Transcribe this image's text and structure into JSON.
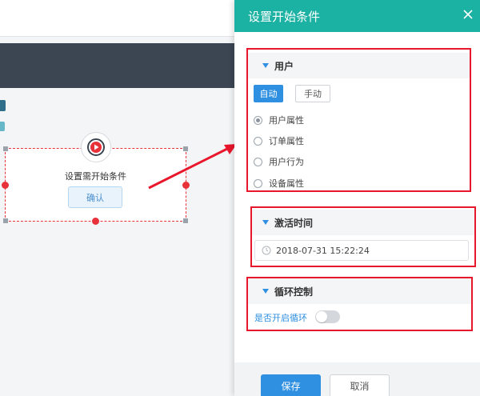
{
  "canvas": {
    "node": {
      "title": "设置需开始条件",
      "confirm_label": "确认",
      "icon": "play-icon"
    }
  },
  "panel": {
    "title": "设置开始条件",
    "close_icon": "close-icon",
    "user_section": {
      "label": "用户",
      "mode_auto": "自动",
      "mode_manual": "手动",
      "options": [
        {
          "label": "用户属性",
          "checked": true
        },
        {
          "label": "订单属性",
          "checked": false
        },
        {
          "label": "用户行为",
          "checked": false
        },
        {
          "label": "设备属性",
          "checked": false
        }
      ]
    },
    "activation_section": {
      "label": "激活时间",
      "datetime": "2018-07-31 15:22:24",
      "icon": "clock-icon"
    },
    "loop_section": {
      "label": "循环控制",
      "toggle_label": "是否开启循环",
      "toggle_on": false
    },
    "footer": {
      "save_label": "保存",
      "cancel_label": "取消"
    }
  },
  "colors": {
    "header": "#1bb1a3",
    "accent": "#2f8fe0",
    "highlight": "#e8172b"
  }
}
